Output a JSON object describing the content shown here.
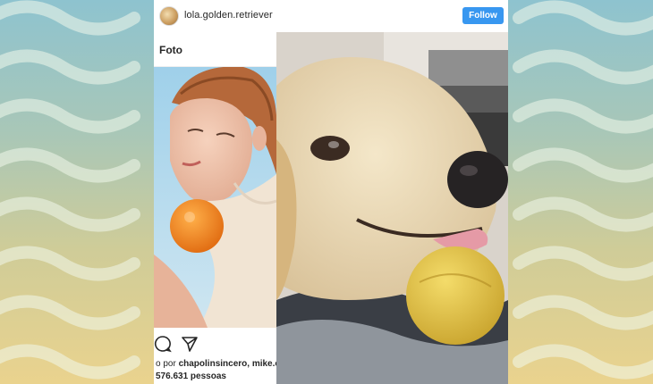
{
  "post": {
    "username": "lola.golden.retriever",
    "follow_label": "Follow"
  },
  "left_panel": {
    "title": "Foto",
    "liked_prefix": "o por ",
    "liked_users": "chapolinsincero, mike.ch",
    "people_count": "576.631 pessoas"
  },
  "icons": [
    "comment-icon",
    "share-icon"
  ],
  "colors": {
    "follow_button": "#3897f0",
    "background_top": "#8ec3cf",
    "background_bottom": "#ead38e"
  }
}
